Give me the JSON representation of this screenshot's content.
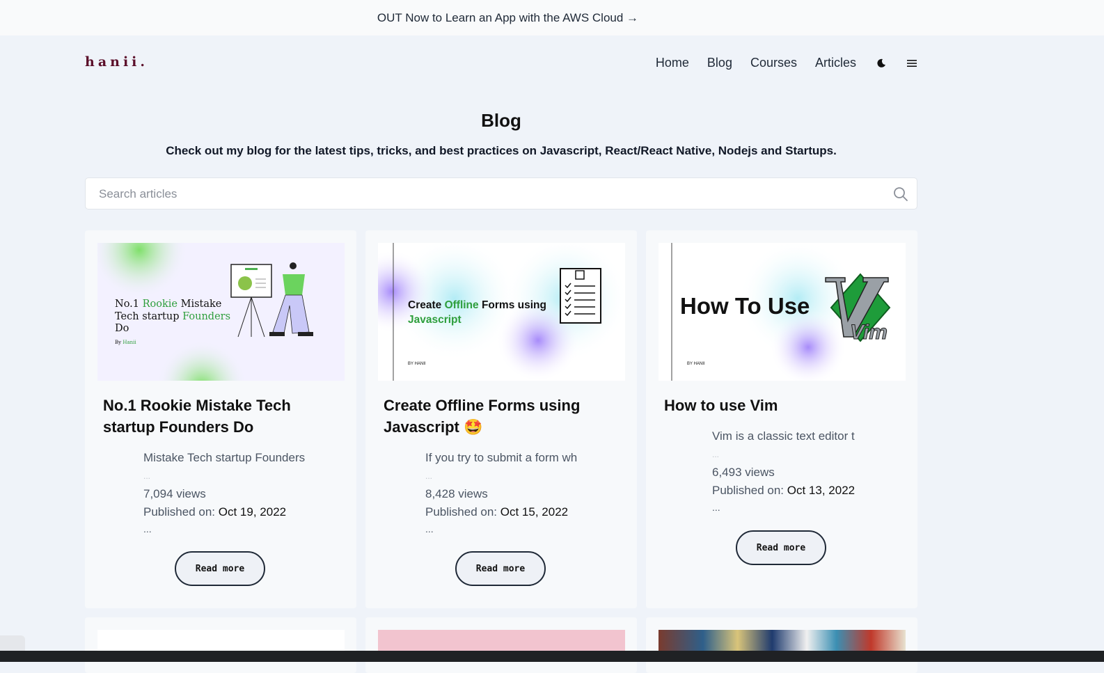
{
  "promo": {
    "text": "OUT Now to Learn an App with the AWS Cloud →"
  },
  "brand": {
    "logo": "hanii."
  },
  "nav": {
    "items": [
      "Home",
      "Blog",
      "Courses",
      "Articles"
    ],
    "icons": [
      "moon-icon",
      "menu-icon"
    ]
  },
  "page": {
    "title": "Blog",
    "subtitle": "Check out my blog for the latest tips, tricks, and best practices on Javascript, React/React Native, Nodejs and Startups."
  },
  "search": {
    "placeholder": "Search articles",
    "value": "",
    "icon": "search-icon"
  },
  "posts": [
    {
      "title": "No.1 Rookie Mistake Tech startup Founders Do",
      "excerpt": "Mistake Tech startup Founders",
      "views": "7,094 views",
      "published_label": "Published on:",
      "date": "Oct 19, 2022",
      "ellipsis": "...",
      "read_more": "Read more",
      "thumb": {
        "l1a": "No.1",
        "l1b": "Rookie",
        "l1c": "Mistake",
        "l2a": "Tech startup",
        "l2b": "Founders",
        "l3": "Do",
        "by": "By",
        "author": "Hanii"
      }
    },
    {
      "title": "Create Offline Forms using Javascript",
      "emoji": "🤩",
      "excerpt": "If you try to submit a form wh",
      "views": "8,428 views",
      "published_label": "Published on:",
      "date": "Oct 15, 2022",
      "ellipsis": "...",
      "read_more": "Read more",
      "thumb": {
        "a": "Create",
        "b": "Offline",
        "c": "Forms using",
        "d": "Javascript",
        "by": "BY HANII"
      }
    },
    {
      "title": "How to use Vim",
      "excerpt": "Vim is a classic text editor t",
      "views": "6,493 views",
      "published_label": "Published on:",
      "date": "Oct 13, 2022",
      "ellipsis": "...",
      "read_more": "Read more",
      "thumb": {
        "text": "How To Use",
        "logo": "Vim",
        "by": "BY HANII"
      }
    }
  ],
  "colors": {
    "background": "#eff3f9",
    "card": "#f7f9fb",
    "brand": "#5b0f2a",
    "green": "#2e9e3c",
    "purple": "#a78bfa"
  }
}
